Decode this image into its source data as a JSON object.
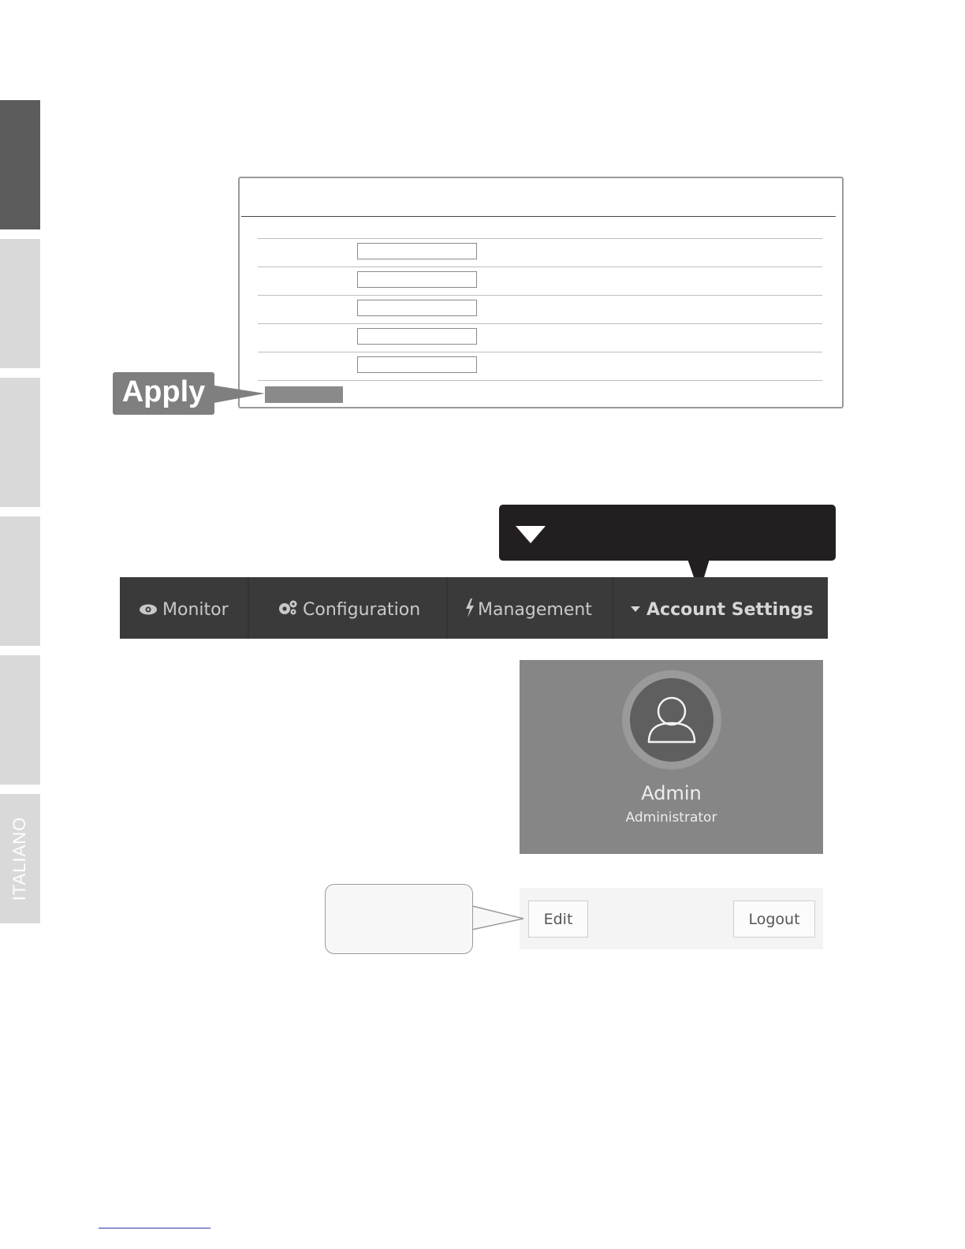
{
  "side_tabs": [
    {
      "label": "",
      "active": true
    },
    {
      "label": "",
      "active": false
    },
    {
      "label": "",
      "active": false
    },
    {
      "label": "",
      "active": false
    },
    {
      "label": "",
      "active": false
    },
    {
      "label": "ITALIANO",
      "active": false
    }
  ],
  "form": {
    "fields": [
      "",
      "",
      "",
      "",
      ""
    ]
  },
  "callouts": {
    "apply": "Apply"
  },
  "navbar": {
    "monitor": "Monitor",
    "configuration": "Configuration",
    "management": "Management",
    "account_settings": "Account Settings"
  },
  "profile": {
    "name": "Admin",
    "role": "Administrator"
  },
  "footer": {
    "edit": "Edit",
    "logout": "Logout"
  },
  "colors": {
    "active_tab": "#5c5c5c",
    "inactive_tab": "#d9d9d9",
    "navbar": "#3a3a3a",
    "callout_dark": "#231f20",
    "callout_apply": "#7f7f7f"
  },
  "icons": {
    "monitor": "eye-icon",
    "configuration": "gears-icon",
    "management": "bolt-icon",
    "account_settings": "caret-down-icon",
    "avatar": "user-icon"
  }
}
